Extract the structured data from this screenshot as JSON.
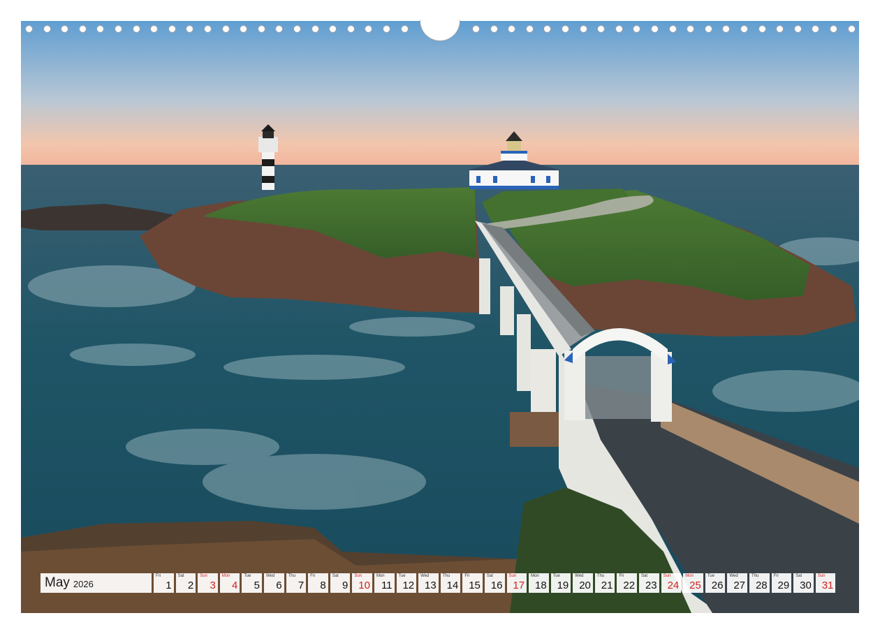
{
  "calendar": {
    "month": "May",
    "year": "2026",
    "days": [
      {
        "wd": "Fri",
        "d": "1",
        "red": false
      },
      {
        "wd": "Sat",
        "d": "2",
        "red": false
      },
      {
        "wd": "Sun",
        "d": "3",
        "red": true
      },
      {
        "wd": "Mon",
        "d": "4",
        "red": true
      },
      {
        "wd": "Tue",
        "d": "5",
        "red": false
      },
      {
        "wd": "Wed",
        "d": "6",
        "red": false
      },
      {
        "wd": "Thu",
        "d": "7",
        "red": false
      },
      {
        "wd": "Fri",
        "d": "8",
        "red": false
      },
      {
        "wd": "Sat",
        "d": "9",
        "red": false
      },
      {
        "wd": "Sun",
        "d": "10",
        "red": true
      },
      {
        "wd": "Mon",
        "d": "11",
        "red": false
      },
      {
        "wd": "Tue",
        "d": "12",
        "red": false
      },
      {
        "wd": "Wed",
        "d": "13",
        "red": false
      },
      {
        "wd": "Thu",
        "d": "14",
        "red": false
      },
      {
        "wd": "Fri",
        "d": "15",
        "red": false
      },
      {
        "wd": "Sat",
        "d": "16",
        "red": false
      },
      {
        "wd": "Sun",
        "d": "17",
        "red": true
      },
      {
        "wd": "Mon",
        "d": "18",
        "red": false
      },
      {
        "wd": "Tue",
        "d": "19",
        "red": false
      },
      {
        "wd": "Wed",
        "d": "20",
        "red": false
      },
      {
        "wd": "Thu",
        "d": "21",
        "red": false
      },
      {
        "wd": "Fri",
        "d": "22",
        "red": false
      },
      {
        "wd": "Sat",
        "d": "23",
        "red": false
      },
      {
        "wd": "Sun",
        "d": "24",
        "red": true
      },
      {
        "wd": "Mon",
        "d": "25",
        "red": true
      },
      {
        "wd": "Tue",
        "d": "26",
        "red": false
      },
      {
        "wd": "Wed",
        "d": "27",
        "red": false
      },
      {
        "wd": "Thu",
        "d": "28",
        "red": false
      },
      {
        "wd": "Fri",
        "d": "29",
        "red": false
      },
      {
        "wd": "Sat",
        "d": "30",
        "red": false
      },
      {
        "wd": "Sun",
        "d": "31",
        "red": true
      }
    ]
  },
  "colors": {
    "holiday": "#d22020",
    "sea": "#1f5566",
    "grass": "#3f6b2c",
    "rock": "#6b4636",
    "accent_blue": "#2a63b8"
  }
}
